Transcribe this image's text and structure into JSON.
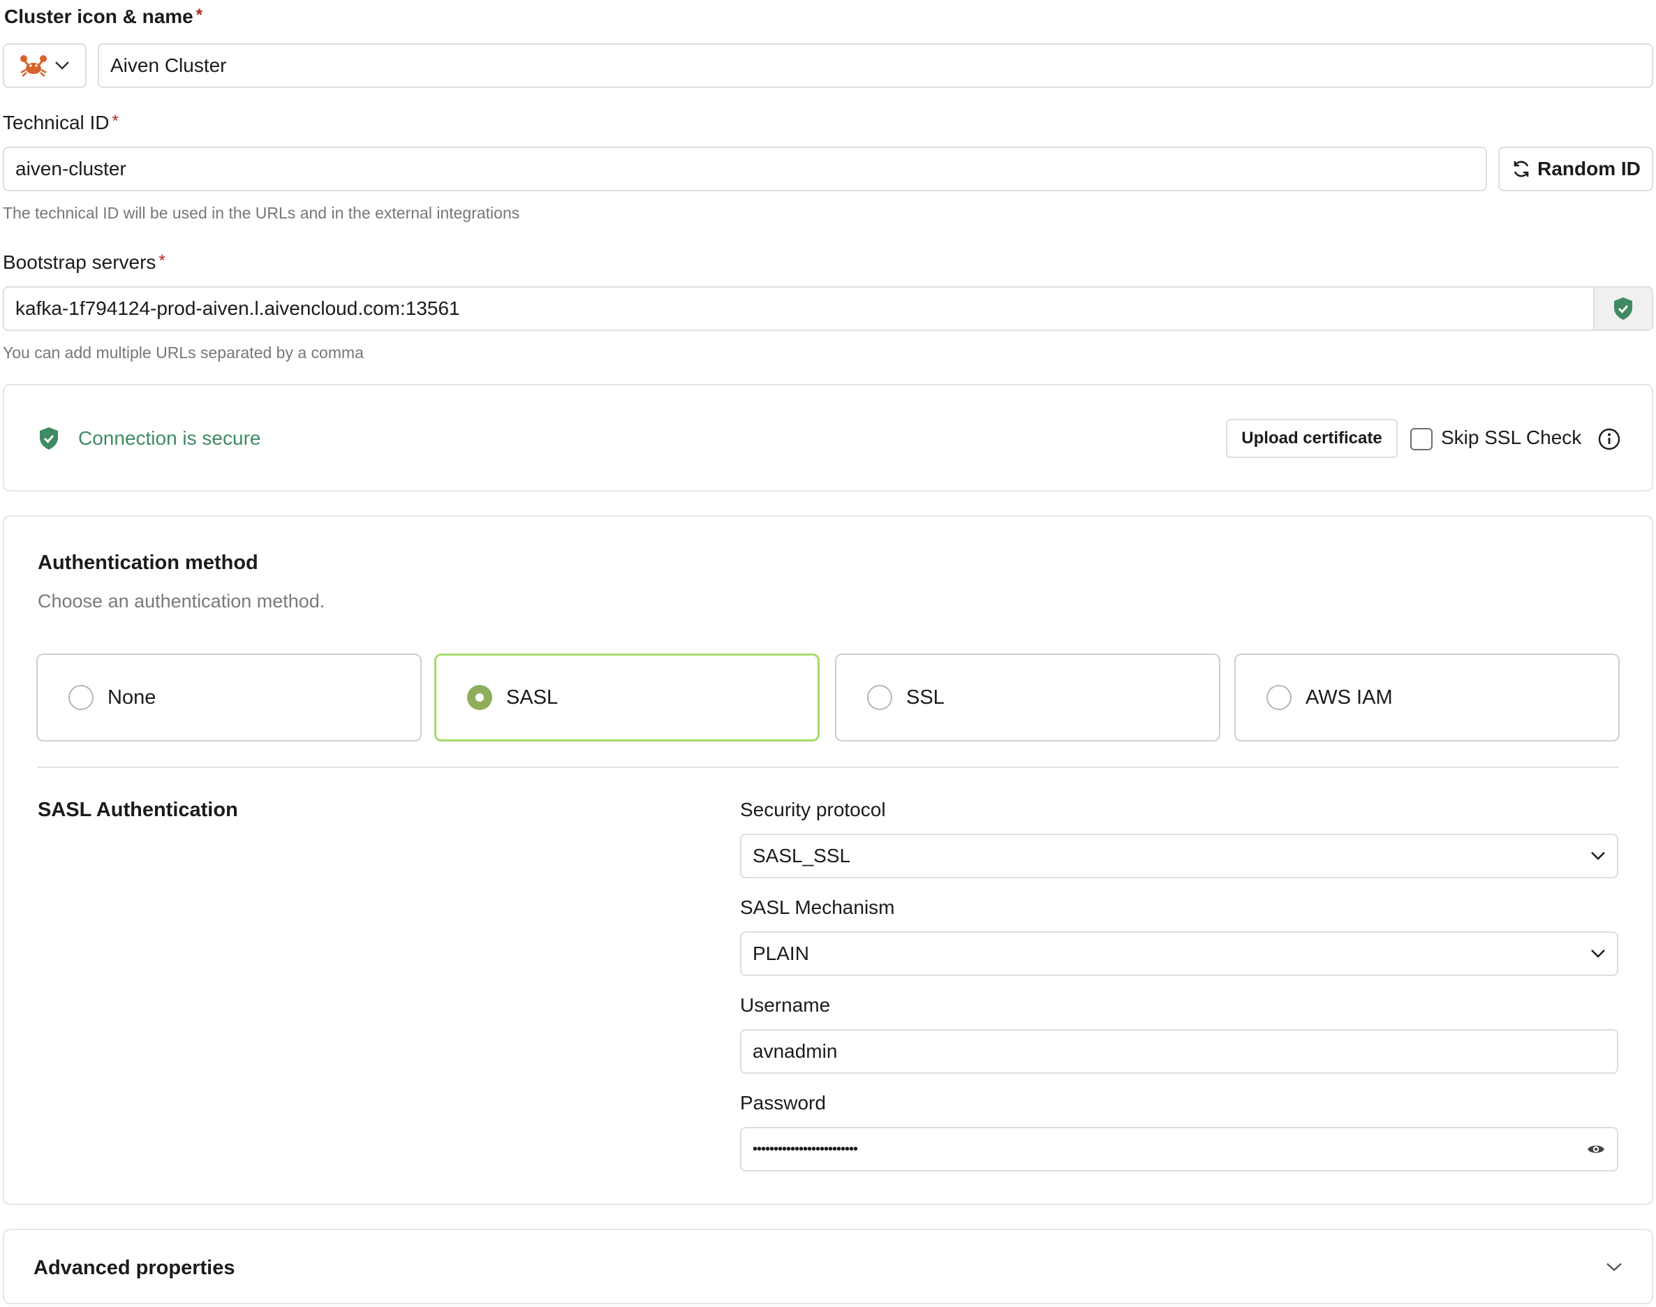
{
  "cluster": {
    "label": "Cluster icon & name",
    "required_mark": "*",
    "icon_name": "crab-icon",
    "name_value": "Aiven Cluster"
  },
  "technical_id": {
    "label": "Technical ID",
    "required_mark": "*",
    "value": "aiven-cluster",
    "random_button": "Random ID",
    "hint": "The technical ID will be used in the URLs and in the external integrations"
  },
  "bootstrap": {
    "label": "Bootstrap servers",
    "required_mark": "*",
    "value": "kafka-1f794124-prod-aiven.l.aivencloud.com:13561",
    "hint": "You can add multiple URLs separated by a comma",
    "status_icon": "shield-check-icon"
  },
  "connection": {
    "status_text": "Connection is secure",
    "upload_button": "Upload certificate",
    "skip_ssl_label": "Skip SSL Check",
    "skip_ssl_checked": false
  },
  "auth": {
    "title": "Authentication method",
    "subtitle": "Choose an authentication method.",
    "options": [
      {
        "label": "None",
        "selected": false
      },
      {
        "label": "SASL",
        "selected": true
      },
      {
        "label": "SSL",
        "selected": false
      },
      {
        "label": "AWS IAM",
        "selected": false
      }
    ]
  },
  "sasl": {
    "section_title": "SASL Authentication",
    "security_protocol_label": "Security protocol",
    "security_protocol_value": "SASL_SSL",
    "mechanism_label": "SASL Mechanism",
    "mechanism_value": "PLAIN",
    "username_label": "Username",
    "username_value": "avnadmin",
    "password_label": "Password",
    "password_value": "•••••••••••••••••••••••••"
  },
  "advanced": {
    "title": "Advanced properties"
  },
  "colors": {
    "secure_green": "#3f8a63",
    "selected_border": "#a6db6a",
    "selected_radio": "#8fae5b",
    "required_red": "#b3261e"
  }
}
